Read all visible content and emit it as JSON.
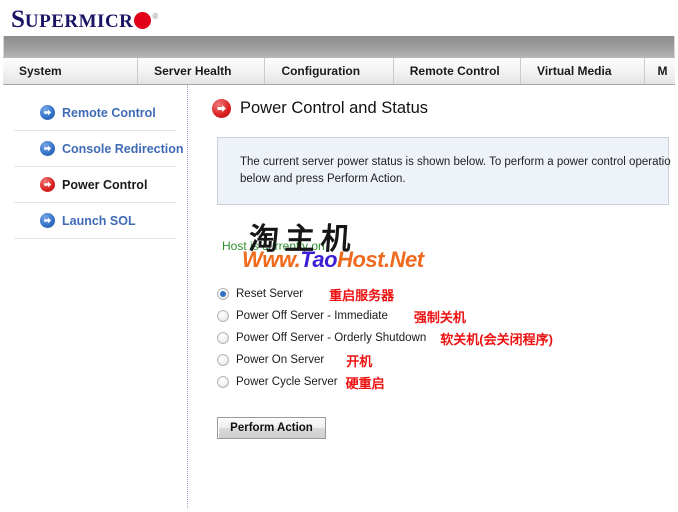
{
  "brand": {
    "name_cap": "S",
    "name_rest": "UPERMICR",
    "registered": "®",
    "logo_name": "supermicro-logo"
  },
  "nav": {
    "tabs": [
      {
        "label": "System"
      },
      {
        "label": "Server Health"
      },
      {
        "label": "Configuration"
      },
      {
        "label": "Remote Control"
      },
      {
        "label": "Virtual Media"
      },
      {
        "label": "M"
      }
    ]
  },
  "sidebar": {
    "items": [
      {
        "label": "Remote Control",
        "active": false
      },
      {
        "label": "Console Redirection",
        "active": false
      },
      {
        "label": "Power Control",
        "active": true
      },
      {
        "label": "Launch SOL",
        "active": false
      }
    ]
  },
  "main": {
    "page_title": "Power Control and Status",
    "info": {
      "line1": "The current server power status is shown below. To perform a power control operatio",
      "line2": "below and press Perform Action."
    },
    "status_text": "Host is currently on",
    "watermark": {
      "chinese": "淘主机",
      "url_part1": "Www.",
      "url_part2": "Tao",
      "url_part3": "Host.Net"
    },
    "options": [
      {
        "label": "Reset Server",
        "note": "重启服务器",
        "checked": true
      },
      {
        "label": "Power Off Server - Immediate",
        "note": "强制关机",
        "checked": false
      },
      {
        "label": "Power Off Server - Orderly Shutdown",
        "note": "软关机(会关闭程序)",
        "checked": false
      },
      {
        "label": "Power On Server",
        "note": "开机",
        "checked": false
      },
      {
        "label": "Power Cycle Server",
        "note": "硬重启",
        "checked": false
      }
    ],
    "perform_button": "Perform Action"
  },
  "colors": {
    "brand_navy": "#1b1464",
    "brand_red": "#e00018",
    "link_blue": "#3f6bb5",
    "status_green": "#2d8f2d",
    "note_red": "#ee1111",
    "info_bg": "#eef2f9"
  }
}
